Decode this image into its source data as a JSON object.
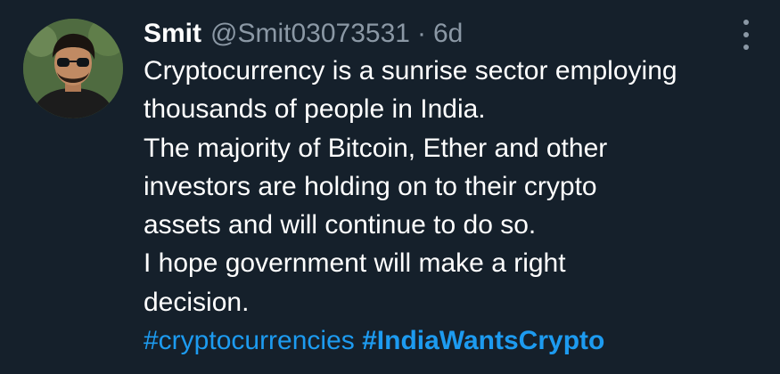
{
  "tweet": {
    "author_name": "Smit",
    "handle": "@Smit03073531",
    "separator": "·",
    "time": "6d",
    "lines": [
      "Cryptocurrency is a sunrise sector employing",
      "thousands of people in India.",
      "The majority of Bitcoin, Ether and other",
      "investors are holding on to their crypto",
      "assets and will continue to do so.",
      "I hope government will make a right",
      "decision."
    ],
    "hashtags": [
      "#cryptocurrencies",
      "#IndiaWantsCrypto"
    ]
  },
  "icons": {
    "avatar": "profile-photo",
    "more": "more-vertical-icon"
  },
  "colors": {
    "background": "#15202b",
    "text": "#ffffff",
    "secondary": "#8b98a5",
    "link": "#1d9bf0"
  }
}
